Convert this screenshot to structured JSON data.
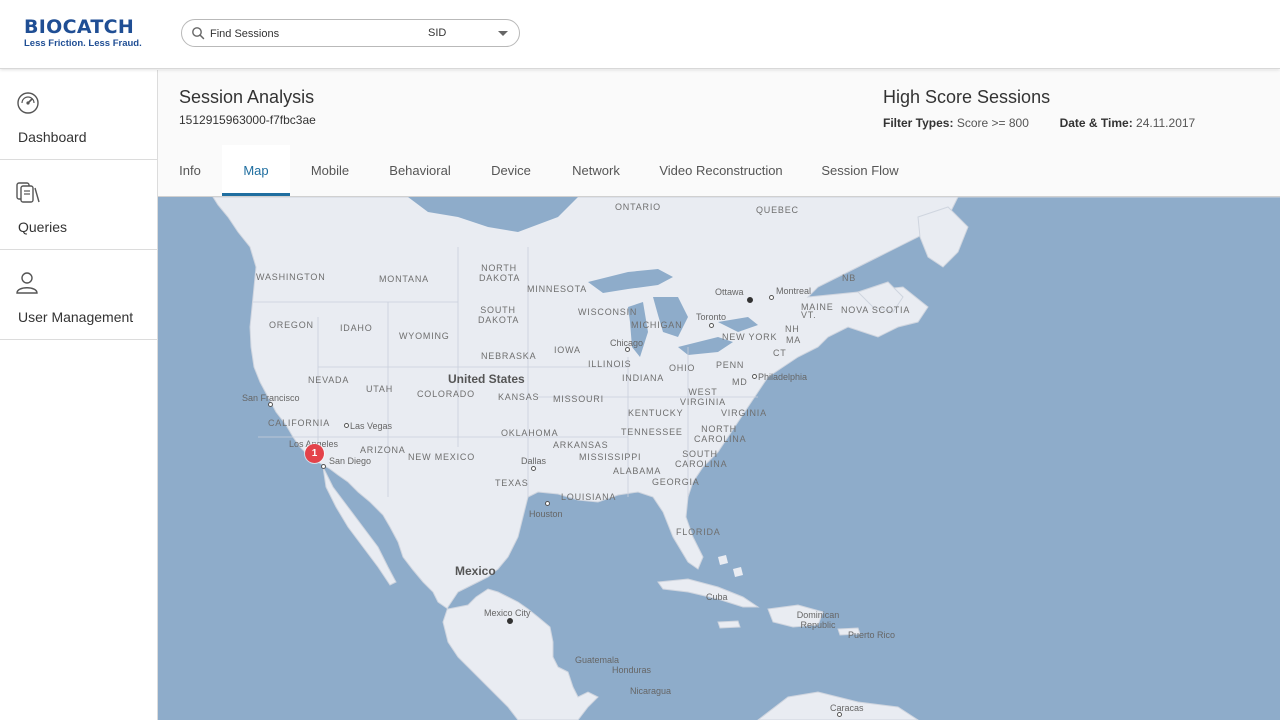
{
  "brand": {
    "name": "BIOCATCH",
    "tagline": "Less Friction. Less Fraud."
  },
  "search": {
    "placeholder": "Find Sessions",
    "type_selected": "SID"
  },
  "sidebar": {
    "items": [
      {
        "label": "Dashboard",
        "icon": "speedometer-icon"
      },
      {
        "label": "Queries",
        "icon": "queries-icon"
      },
      {
        "label": "User Management",
        "icon": "user-icon"
      }
    ]
  },
  "session": {
    "title": "Session Analysis",
    "id": "1512915963000-f7fbc3ae"
  },
  "high_score": {
    "title": "High Score Sessions",
    "filter_label": "Filter Types:",
    "filter_value": "Score >= 800",
    "date_label": "Date & Time:",
    "date_value": "24.11.2017"
  },
  "tabs": [
    {
      "label": "Info"
    },
    {
      "label": "Map",
      "active": true
    },
    {
      "label": "Mobile"
    },
    {
      "label": "Behavioral"
    },
    {
      "label": "Device"
    },
    {
      "label": "Network"
    },
    {
      "label": "Video Reconstruction"
    },
    {
      "label": "Session Flow"
    }
  ],
  "map": {
    "marker_count": "1",
    "countries": [
      "United States",
      "Mexico"
    ],
    "regions": [
      "ONTARIO",
      "QUEBEC",
      "WASHINGTON",
      "MONTANA",
      "NORTH DAKOTA",
      "MINNESOTA",
      "OREGON",
      "IDAHO",
      "WYOMING",
      "SOUTH DAKOTA",
      "WISCONSIN",
      "MICHIGAN",
      "NEBRASKA",
      "IOWA",
      "NEVADA",
      "UTAH",
      "COLORADO",
      "KANSAS",
      "MISSOURI",
      "ILLINOIS",
      "INDIANA",
      "OHIO",
      "PENN",
      "NEW YORK",
      "CALIFORNIA",
      "ARIZONA",
      "NEW MEXICO",
      "OKLAHOMA",
      "ARKANSAS",
      "TENNESSEE",
      "KENTUCKY",
      "WEST VIRGINIA",
      "VIRGINIA",
      "NORTH CAROLINA",
      "SOUTH CAROLINA",
      "MISSISSIPPI",
      "ALABAMA",
      "GEORGIA",
      "TEXAS",
      "LOUISIANA",
      "FLORIDA",
      "MAINE",
      "VT.",
      "NH",
      "MA",
      "CT",
      "MD",
      "NB",
      "NOVA SCOTIA"
    ],
    "cities": [
      "Ottawa",
      "Montreal",
      "Toronto",
      "Chicago",
      "Philadelphia",
      "San Francisco",
      "Las Vegas",
      "Los Angeles",
      "San Diego",
      "Dallas",
      "Houston",
      "Mexico City",
      "Cuba",
      "Dominican Republic",
      "Puerto Rico",
      "Guatemala",
      "Honduras",
      "Nicaragua",
      "Caracas"
    ]
  }
}
